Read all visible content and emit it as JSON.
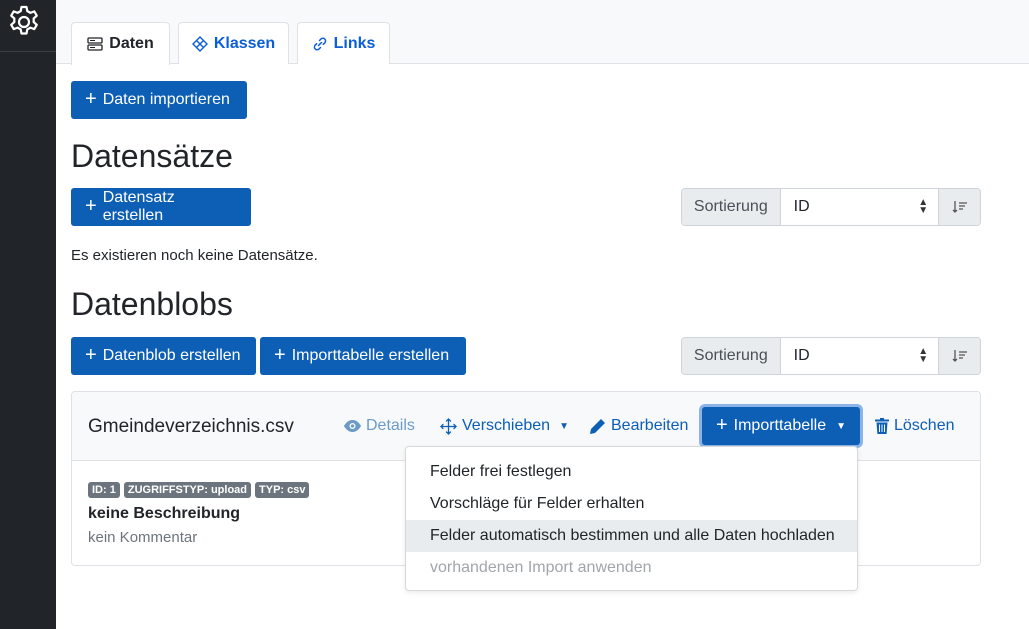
{
  "tabs": [
    {
      "label": "Daten",
      "icon": "server-icon",
      "active": true
    },
    {
      "label": "Klassen",
      "icon": "diagram-icon",
      "active": false
    },
    {
      "label": "Links",
      "icon": "link-icon",
      "active": false
    }
  ],
  "import_data_label": "Daten importieren",
  "records": {
    "heading": "Datensätze",
    "create_label": "Datensatz erstellen",
    "sort_label": "Sortierung",
    "sort_value": "ID",
    "empty_text": "Es existieren noch keine Datensätze."
  },
  "blobs": {
    "heading": "Datenblobs",
    "create_label": "Datenblob erstellen",
    "import_table_label": "Importtabelle erstellen",
    "sort_label": "Sortierung",
    "sort_value": "ID"
  },
  "blob_card": {
    "filename": "Gmeindeverzeichnis.csv",
    "actions": {
      "details": "Details",
      "move": "Verschieben",
      "edit": "Bearbeiten",
      "import_table": "Importtabelle",
      "delete": "Löschen"
    },
    "badges": [
      "ID: 1",
      "ZUGRIFFSTYP: upload",
      "TYP: csv"
    ],
    "description": "keine Beschreibung",
    "comment": "kein Kommentar"
  },
  "dropdown_items": [
    {
      "label": "Felder frei festlegen",
      "state": "normal"
    },
    {
      "label": "Vorschläge für Felder erhalten",
      "state": "normal"
    },
    {
      "label": "Felder automatisch bestimmen und alle Daten hochladen",
      "state": "hover"
    },
    {
      "label": "vorhandenen Import anwenden",
      "state": "disabled"
    }
  ],
  "colors": {
    "primary": "#0d5eb5",
    "sidebar": "#212529",
    "badge": "#6c757d"
  }
}
